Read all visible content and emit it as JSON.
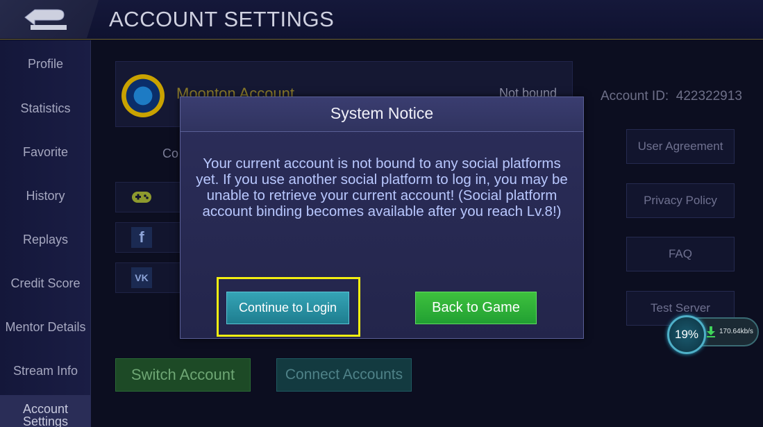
{
  "header": {
    "title": "ACCOUNT SETTINGS",
    "back_icon": "back-arrow-icon"
  },
  "sidebar": {
    "items": [
      {
        "label": "Profile"
      },
      {
        "label": "Statistics"
      },
      {
        "label": "Favorite"
      },
      {
        "label": "History"
      },
      {
        "label": "Replays"
      },
      {
        "label": "Credit Score"
      },
      {
        "label": "Mentor Details"
      },
      {
        "label": "Stream Info"
      },
      {
        "label": "Account Settings"
      }
    ]
  },
  "account": {
    "moonton_name": "Moonton Account",
    "status": "Not bound",
    "connect_text": "Co",
    "account_id_label": "Account ID:",
    "account_id": "422322913",
    "switch_label": "Switch Account",
    "connect_label": "Connect Accounts",
    "social_icons": [
      "gamepad-icon",
      "facebook-icon",
      "vk-icon"
    ]
  },
  "right_buttons": [
    {
      "label": "User Agreement"
    },
    {
      "label": "Privacy Policy"
    },
    {
      "label": "FAQ"
    },
    {
      "label": "Test Server"
    }
  ],
  "modal": {
    "title": "System Notice",
    "message": "Your current account is not bound to any social platforms yet. If you use another social platform to log in, you may be unable to retrieve your current account! (Social platform account binding becomes available after you reach Lv.8!)",
    "login_label": "Continue to Login",
    "back_label": "Back to Game"
  },
  "download": {
    "percent": "19%",
    "speed": "170.64kb/s"
  },
  "colors": {
    "highlight": "#f2ee11",
    "green_button": "#21a032",
    "teal_button": "#1e7d8f"
  }
}
